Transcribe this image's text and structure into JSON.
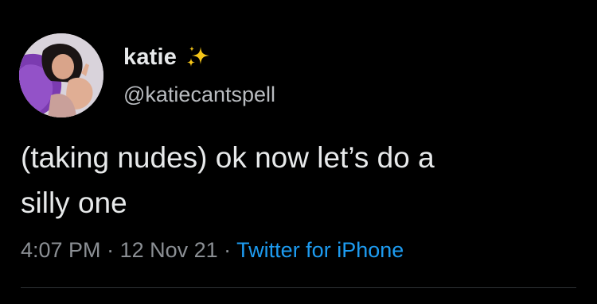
{
  "tweet": {
    "display_name": "katie",
    "handle": "@katiecantspell",
    "text_line1": "(taking nudes) ok now let’s do a",
    "text_line2": "silly one",
    "time": "4:07 PM",
    "separator1": " · ",
    "date": "12 Nov 21",
    "separator2": " · ",
    "source": "Twitter for iPhone",
    "name_emoji_icon": "sparkles-icon"
  },
  "colors": {
    "background": "#000000",
    "primary_text": "#e7e9ea",
    "secondary_text": "#8b8f94",
    "link": "#1d9bf0",
    "sparkle": "#f5c518"
  }
}
